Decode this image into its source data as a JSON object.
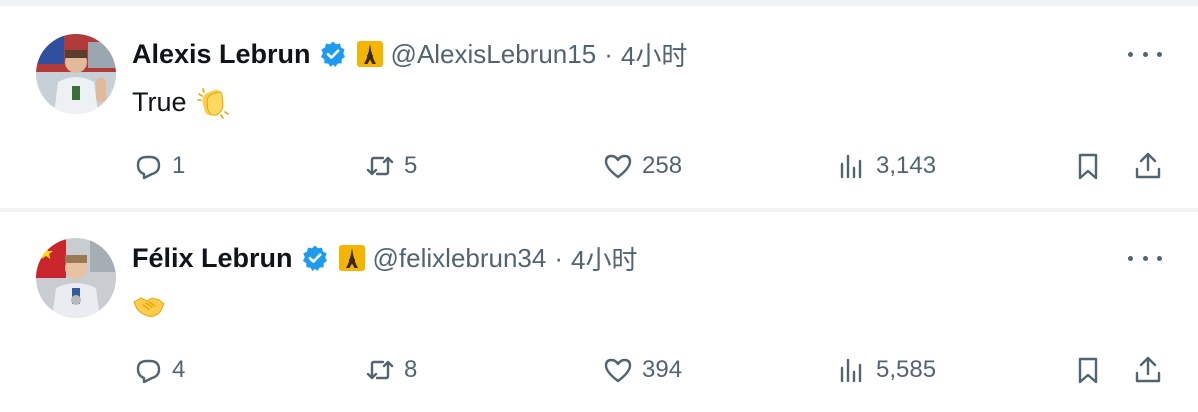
{
  "tweets": [
    {
      "name": "Alexis Lebrun",
      "handle": "@AlexisLebrun15",
      "separator": "·",
      "time": "4小时",
      "text": "True",
      "emoji": "clapping-hands",
      "replies": "1",
      "retweets": "5",
      "likes": "258",
      "views": "3,143"
    },
    {
      "name": "Félix Lebrun",
      "handle": "@felixlebrun34",
      "separator": "·",
      "time": "4小时",
      "text": "",
      "emoji": "handshake",
      "replies": "4",
      "retweets": "8",
      "likes": "394",
      "views": "5,585"
    }
  ],
  "colors": {
    "text_primary": "#0f1419",
    "text_secondary": "#536471",
    "verified_blue": "#1d9bf0",
    "divider": "#eff3f4"
  },
  "icons": [
    "verified-badge-icon",
    "eiffel-tower-badge-icon",
    "more-icon",
    "reply-icon",
    "retweet-icon",
    "like-icon",
    "views-icon",
    "bookmark-icon",
    "share-icon"
  ]
}
